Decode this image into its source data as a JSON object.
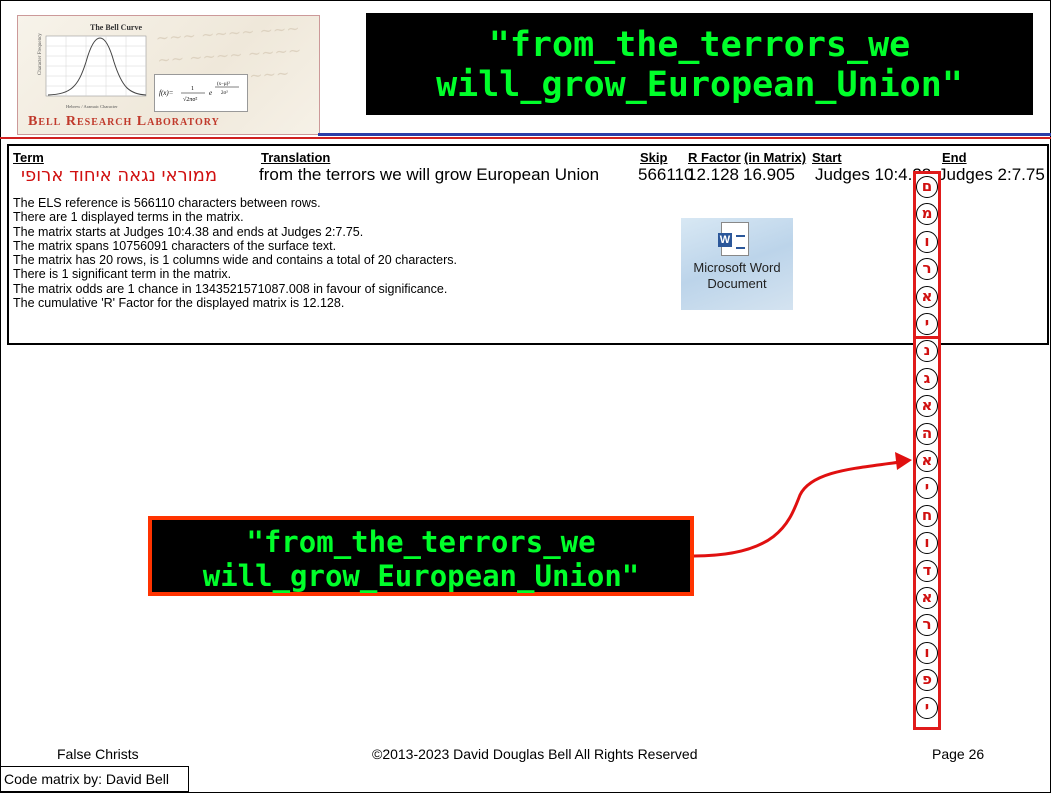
{
  "logo": {
    "chart_title": "The Bell Curve",
    "name": "Bell Research Laboratory",
    "axis_x_label": "Hebrew / Aramaic Character",
    "axis_y_label": "Character Frequency"
  },
  "title": "\"from_the_terrors_we will_grow_European_Union\"",
  "table": {
    "headers": {
      "term": "Term",
      "translation": "Translation",
      "skip": "Skip",
      "rfactor": "R Factor",
      "in_matrix": "(in Matrix)",
      "start": "Start",
      "end": "End"
    },
    "row": {
      "term": "ממוראי נגאה איחוד ארופי",
      "translation": "from the terrors we will grow European Union",
      "skip": "566110",
      "rfactor": "12.128",
      "in_matrix": "16.905",
      "start": "Judges 10:4.38",
      "end": "Judges 2:7.75"
    }
  },
  "notes": [
    "The ELS reference is 566110 characters between rows.",
    "There are 1 displayed terms in the matrix.",
    "The matrix starts at Judges 10:4.38 and ends at Judges 2:7.75.",
    "The matrix spans 10756091 characters of the surface text.",
    "The matrix has 20 rows, is 1 columns wide and contains a total of 20 characters.",
    "There is 1 significant term in the matrix.",
    "The matrix odds are 1 chance in 1343521571087.008  in favour of significance.",
    "The cumulative 'R' Factor for the displayed matrix is 12.128."
  ],
  "embedded_object": {
    "icon": "word-document-icon",
    "label": "Microsoft Word Document"
  },
  "matrix_letters": [
    "ם",
    "מ",
    "ו",
    "ר",
    "א",
    "י",
    "נ",
    "ג",
    "א",
    "ה",
    "א",
    "י",
    "ח",
    "ו",
    "ד",
    "א",
    "ר",
    "ו",
    "פ",
    "י"
  ],
  "callout": "\"from_the_terrors_we will_grow_European_Union\"",
  "footer": {
    "left": "False Christs",
    "center": "©2013-2023 David Douglas Bell All Rights Reserved",
    "right": "Page 26",
    "credit": "Code matrix by: David Bell"
  },
  "colors": {
    "title_text": "#00ff2a",
    "hebrew": "#d01010",
    "accent_red": "#e01b1b",
    "rule_blue": "#2a3ea8"
  }
}
